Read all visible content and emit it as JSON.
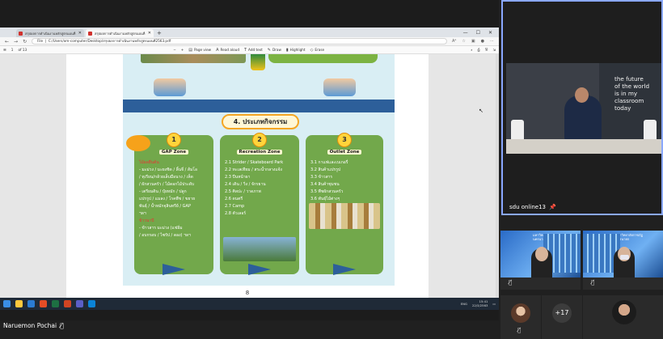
{
  "browser": {
    "tabs": [
      {
        "label": "สรุปผลการดำเนินงานหลักสูตรแผนที่",
        "active": false
      },
      {
        "label": "สรุปผลการดำเนินงานหลักสูตรแผนที่",
        "active": true
      }
    ],
    "new_tab": "+",
    "window_controls": [
      "—",
      "☐",
      "✕"
    ],
    "nav": {
      "back": "←",
      "forward": "→",
      "refresh": "↻"
    },
    "url_prefix": "File",
    "url": "C:/Users/om-computer/Desktop/สรุปผลการดำเนินงานหลักสูตรแผนที่2563.pdf"
  },
  "pdf_toolbar": {
    "page_current": "1",
    "page_total": "of 13",
    "zoom_minus": "−",
    "zoom_plus": "+",
    "page_view": "Page view",
    "read_aloud": "Read aloud",
    "add_text": "Add text",
    "draw": "Draw",
    "highlight": "Highlight",
    "erase": "Erase"
  },
  "infographic": {
    "title": "4. ประเภทกิจกรรม",
    "zones": [
      {
        "number": "1",
        "name": "GAP Zone",
        "lines": [
          {
            "text": "ไม้ผลยืนต้น",
            "red": true
          },
          {
            "text": "- มะม่วง / มะยงชิด / ลิ้นจี่ / ส้มโอ",
            "red": false
          },
          {
            "text": "/ ทุเรียน/กล้วยเล็บมือนาง / เห็ด",
            "red": false
          },
          {
            "text": "/ ผักสวนครัว / ไม้ดอกไม้ประดับ",
            "red": false
          },
          {
            "text": "- เตรียมดิน / ปุ๋ยหมัก / ปลูก",
            "red": false
          },
          {
            "text": "แปรรูป / แมลง / โรคพืช / ขยาย",
            "red": false
          },
          {
            "text": "พันธุ์ / น้ำหมักจุลินทรีย์ / GAP",
            "red": false
          },
          {
            "text": "ฯลฯ",
            "red": false
          },
          {
            "text": "ข้าวนาปี",
            "red": true
          },
          {
            "text": "- ข้าวสาร มะม่วง (แช่อิ่ม",
            "red": false
          },
          {
            "text": "/ อบกรอบ / ไซรัป / ดอง) ฯลฯ",
            "red": false
          }
        ]
      },
      {
        "number": "2",
        "name": "Recreation Zone",
        "lines": [
          {
            "text": "2.1 Strider / Skateboard Park",
            "red": false
          },
          {
            "text": "2.2 ทะเลเทียม / สระน้ำกลางแจ้ง",
            "red": false
          },
          {
            "text": "2.3 ปีนหน้าผา",
            "red": false
          },
          {
            "text": "2.4 เดิน / วิ่ง / จักรยาน",
            "red": false
          },
          {
            "text": "2.5 ศิลปะ / วาดภาพ",
            "red": false
          },
          {
            "text": "2.6 ดนตรี",
            "red": false
          },
          {
            "text": "2.7 Camp",
            "red": false
          },
          {
            "text": "2.8 ตัวเลอร์",
            "red": false
          }
        ]
      },
      {
        "number": "3",
        "name": "Outlet Zone",
        "lines": [
          {
            "text": "3.1 กาแฟและเบเกอรี่",
            "red": false
          },
          {
            "text": "3.2 สินค้าแปรรูป",
            "red": false
          },
          {
            "text": "3.3 ข้าวสาร",
            "red": false
          },
          {
            "text": "3.4 สินค้าชุมชน",
            "red": false
          },
          {
            "text": "3.5 พืชผักสวนครัว",
            "red": false
          },
          {
            "text": "3.6 พันธุ์ไม้ต่างๆ",
            "red": false
          }
        ]
      }
    ],
    "page_number": "8"
  },
  "taskbar": {
    "tray_lang": "ENG",
    "time": "15:41",
    "date": "22/3/2563"
  },
  "meeting": {
    "main_tile": {
      "name": "sdu online13",
      "wall_text": [
        "the future",
        "of the world",
        "is in my",
        "classroom",
        "today"
      ]
    },
    "tile_a": {
      "wall_label": [
        "มหาวิทยาลัยราชภัฏ",
        "นครนายก"
      ],
      "muted": true
    },
    "tile_b": {
      "wall_label": [
        "มหาวิทยาลัยราชภัฏ",
        "นครนายก"
      ],
      "muted": true
    },
    "overflow_count": "+17",
    "self_name": "Naruemon Pochai"
  },
  "colors": {
    "zone_green": "#72a84b",
    "band_blue": "#2d5f9a",
    "active_speaker_border": "#8aa8ff"
  }
}
